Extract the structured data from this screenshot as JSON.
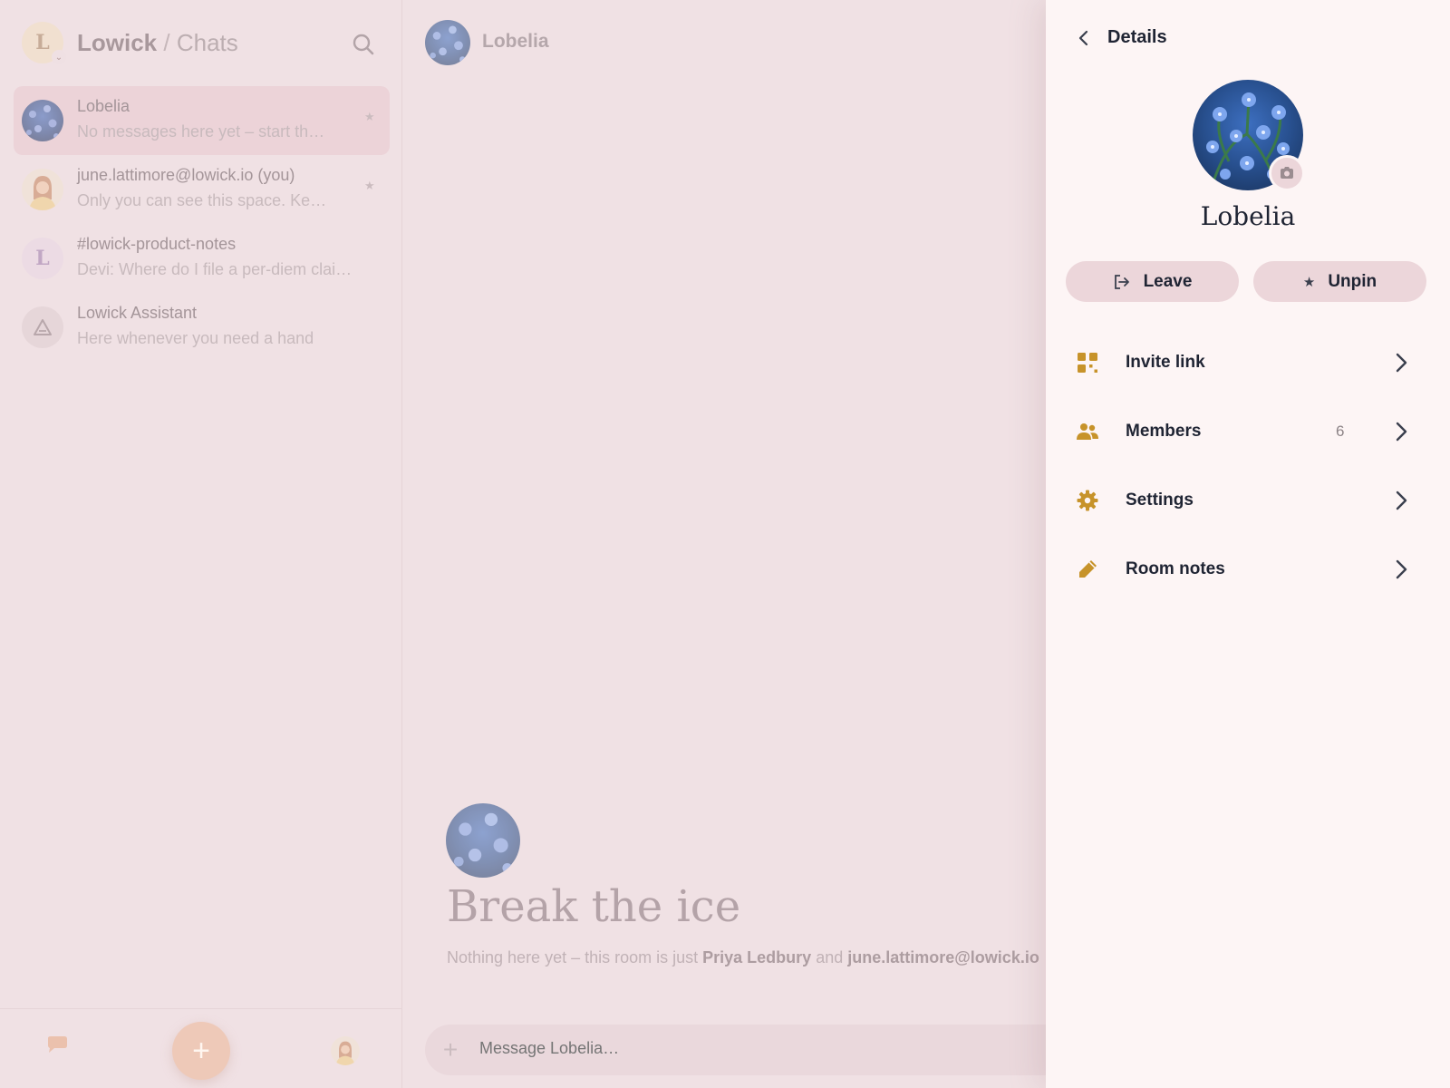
{
  "workspace": {
    "initial": "L",
    "name": "Lowick",
    "separator": "/",
    "section": "Chats"
  },
  "chats": [
    {
      "name": "Lobelia",
      "preview": "No messages here yet – start th…",
      "pinned": true,
      "active": true
    },
    {
      "name": "june.lattimore@lowick.io (you)",
      "preview": "Only you can see this space. Ke…",
      "pinned": true,
      "active": false
    },
    {
      "name": "#lowick-product-notes",
      "initial": "L",
      "preview": "Devi: Where do I file a per-diem clai…",
      "pinned": false,
      "active": false
    },
    {
      "name": "Lowick Assistant",
      "preview": "Here whenever you need a hand",
      "pinned": false,
      "active": false
    }
  ],
  "bottom_nav": {
    "new_label": "+"
  },
  "room": {
    "title": "Lobelia",
    "intro_title": "Break the ice",
    "intro_prefix": "Nothing here yet – this room is just ",
    "intro_user1": "Priya Ledbury",
    "intro_and": " and ",
    "intro_user2": "june.lattimore@lowick.io",
    "composer_placeholder": "Message Lobelia…"
  },
  "details": {
    "title": "Details",
    "name": "Lobelia",
    "leave_label": "Leave",
    "unpin_label": "Unpin",
    "menu": [
      {
        "label": "Invite link",
        "icon": "qr-code-icon",
        "count": ""
      },
      {
        "label": "Members",
        "icon": "people-icon",
        "count": "6"
      },
      {
        "label": "Settings",
        "icon": "gear-icon",
        "count": ""
      },
      {
        "label": "Room notes",
        "icon": "pencil-icon",
        "count": ""
      }
    ]
  },
  "colors": {
    "accent": "#c7932a",
    "panel_bg": "#fdf5f5",
    "overlay_bg": "#f0e1e4",
    "button_bg": "#ecd6da",
    "text_dark": "#1f2433"
  }
}
